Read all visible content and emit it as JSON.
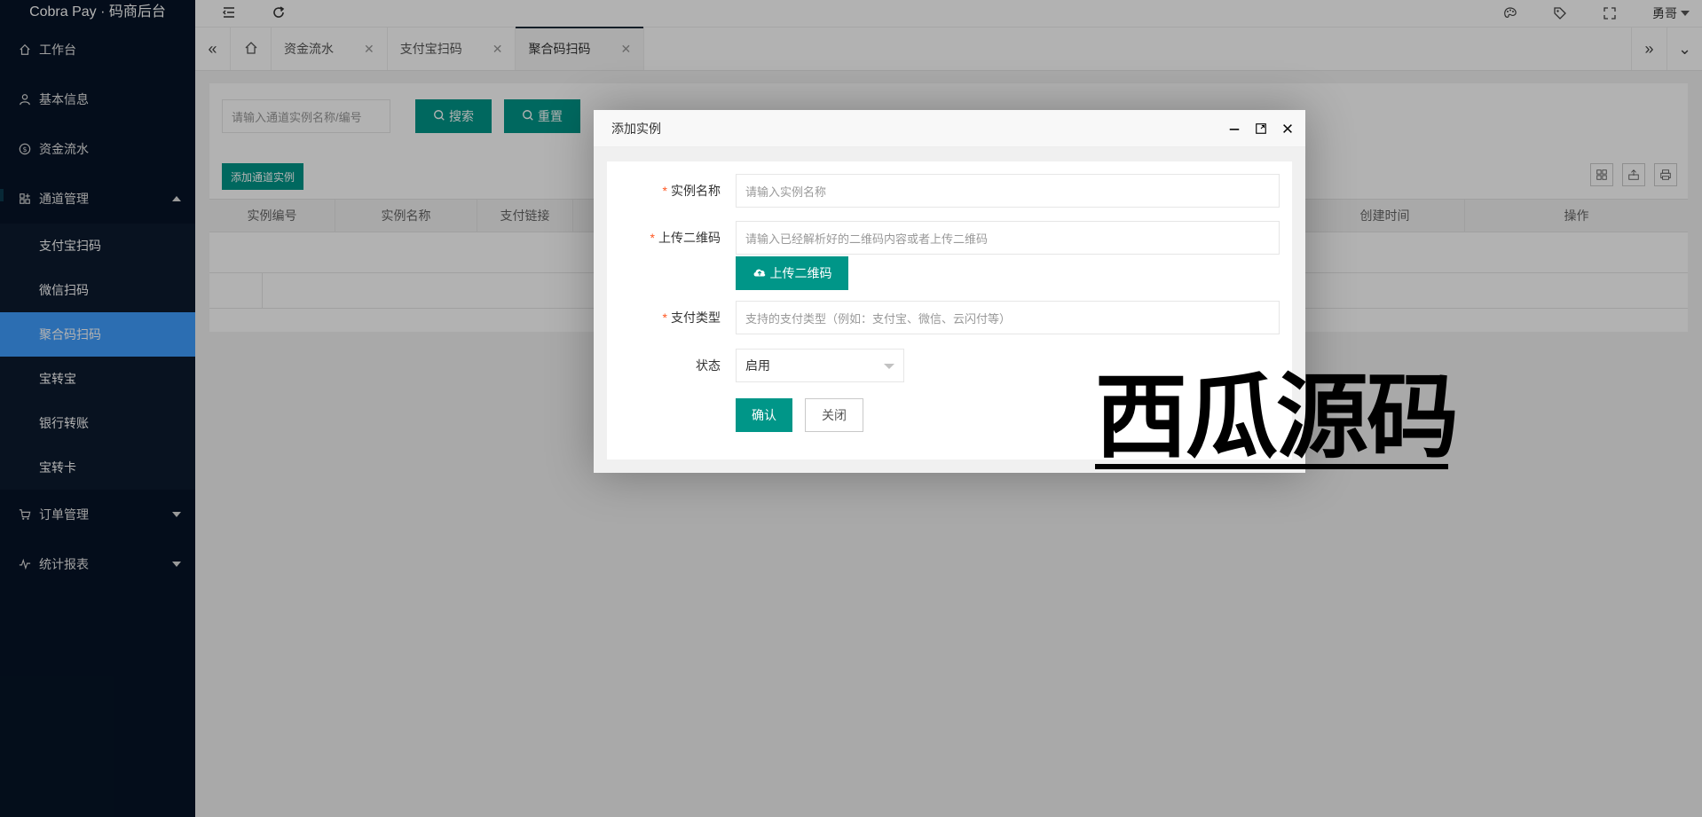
{
  "app": {
    "title": "Cobra Pay · 码商后台"
  },
  "sidebar": {
    "items": [
      {
        "label": "工作台",
        "icon": "home-icon"
      },
      {
        "label": "基本信息",
        "icon": "user-icon"
      },
      {
        "label": "资金流水",
        "icon": "dollar-icon"
      },
      {
        "label": "通道管理",
        "icon": "apps-icon",
        "expanded": true,
        "children": [
          {
            "label": "支付宝扫码"
          },
          {
            "label": "微信扫码"
          },
          {
            "label": "聚合码扫码",
            "active": true
          },
          {
            "label": "宝转宝"
          },
          {
            "label": "银行转账"
          },
          {
            "label": "宝转卡"
          }
        ]
      },
      {
        "label": "订单管理",
        "icon": "cart-icon"
      },
      {
        "label": "统计报表",
        "icon": "chart-icon"
      }
    ]
  },
  "topbar": {
    "user": "勇哥"
  },
  "tabs": [
    {
      "label": "资金流水"
    },
    {
      "label": "支付宝扫码"
    },
    {
      "label": "聚合码扫码",
      "active": true
    }
  ],
  "search": {
    "placeholder": "请输入通道实例名称/编号",
    "search_label": "搜索",
    "reset_label": "重置"
  },
  "table": {
    "add_label": "添加通道实例",
    "columns": [
      "实例编号",
      "实例名称",
      "支付链接",
      "创建时间",
      "操作"
    ]
  },
  "modal": {
    "title": "添加实例",
    "fields": {
      "name_label": "实例名称",
      "name_placeholder": "请输入实例名称",
      "qr_label": "上传二维码",
      "qr_placeholder": "请输入已经解析好的二维码内容或者上传二维码",
      "upload_label": "上传二维码",
      "paytype_label": "支付类型",
      "paytype_placeholder": "支持的支付类型（例如：支付宝、微信、云闪付等）",
      "status_label": "状态",
      "status_value": "启用"
    },
    "confirm_label": "确认",
    "close_label": "关闭"
  },
  "watermark": {
    "text": "西瓜源码"
  },
  "colors": {
    "sidebar_bg": "#061427",
    "accent": "#009688",
    "active_blue": "#409eff",
    "required": "#ff5722"
  }
}
